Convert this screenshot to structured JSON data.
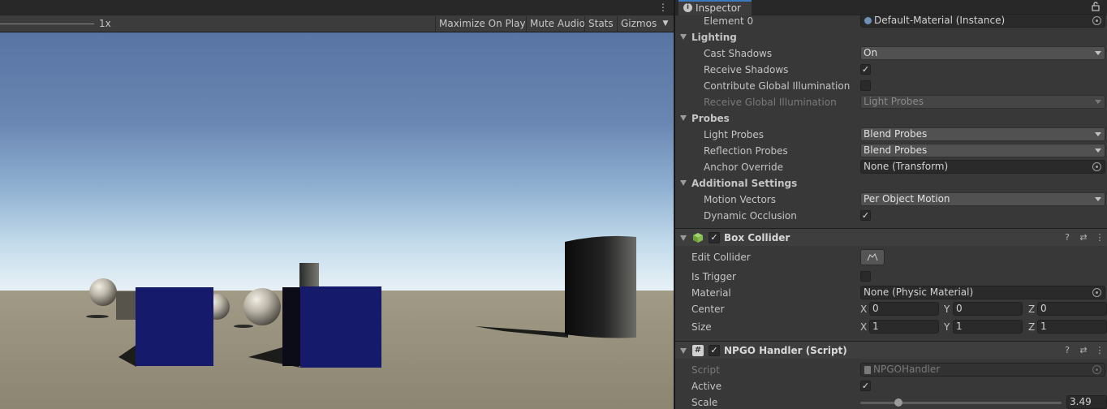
{
  "game_view": {
    "scale_label": "1x",
    "toolbar": {
      "maximize_on_play": "Maximize On Play",
      "mute_audio": "Mute Audio",
      "stats": "Stats",
      "gizmos": "Gizmos"
    },
    "colors": {
      "cube": "#151a6a",
      "sky_top": "#5874a3",
      "ground": "#a09a86"
    }
  },
  "inspector": {
    "tab_label": "Inspector",
    "element0": {
      "label": "Element 0",
      "value": "Default-Material (Instance)"
    },
    "lighting": {
      "title": "Lighting",
      "cast_shadows": {
        "label": "Cast Shadows",
        "value": "On"
      },
      "receive_shadows": {
        "label": "Receive Shadows",
        "checked": true
      },
      "contribute_gi": {
        "label": "Contribute Global Illumination",
        "checked": false
      },
      "receive_gi": {
        "label": "Receive Global Illumination",
        "value": "Light Probes"
      }
    },
    "probes": {
      "title": "Probes",
      "light_probes": {
        "label": "Light Probes",
        "value": "Blend Probes"
      },
      "reflection_probes": {
        "label": "Reflection Probes",
        "value": "Blend Probes"
      },
      "anchor_override": {
        "label": "Anchor Override",
        "value": "None (Transform)"
      }
    },
    "additional": {
      "title": "Additional Settings",
      "motion_vectors": {
        "label": "Motion Vectors",
        "value": "Per Object Motion"
      },
      "dynamic_occlusion": {
        "label": "Dynamic Occlusion",
        "checked": true
      }
    },
    "box_collider": {
      "title": "Box Collider",
      "enabled": true,
      "edit_collider": "Edit Collider",
      "is_trigger": {
        "label": "Is Trigger",
        "checked": false
      },
      "material": {
        "label": "Material",
        "value": "None (Physic Material)"
      },
      "center": {
        "label": "Center",
        "x": "0",
        "y": "0",
        "z": "0"
      },
      "size": {
        "label": "Size",
        "x": "1",
        "y": "1",
        "z": "1"
      },
      "axis_x": "X",
      "axis_y": "Y",
      "axis_z": "Z"
    },
    "npgo_handler": {
      "title": "NPGO Handler (Script)",
      "enabled": true,
      "script": {
        "label": "Script",
        "value": "NPGOHandler"
      },
      "active": {
        "label": "Active",
        "checked": true
      },
      "scale": {
        "label": "Scale",
        "value": "3.49",
        "slider_fraction": 0.19
      }
    }
  }
}
